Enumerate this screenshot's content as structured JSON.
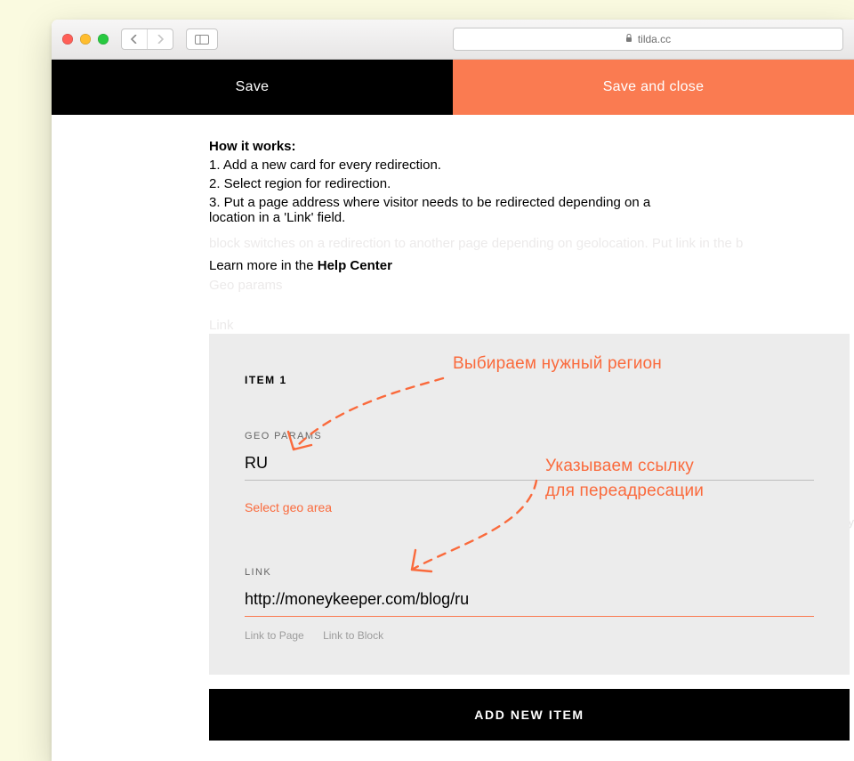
{
  "browser": {
    "domain": "tilda.cc"
  },
  "topbar": {
    "save": "Save",
    "save_close": "Save and close"
  },
  "how": {
    "title": "How it works",
    "l1": "1. Add a new card for every redirection.",
    "l2": "2. Select region for redirection.",
    "l3": "3. Put a page address where visitor needs to be redirected depending on a location in a 'Link' field."
  },
  "learn": {
    "prefix": "Learn more in the ",
    "link": "Help Center"
  },
  "ghost": {
    "g1": "block switches on a redirection to another page depending on geolocation. Put link in the b",
    "g2": "Geo params",
    "g3": "Link"
  },
  "card": {
    "title": "ITEM 1",
    "geo_label": "GEO PARAMS",
    "geo_value": "RU",
    "select_geo": "Select geo area",
    "link_label": "LINK",
    "link_value": "http://moneykeeper.com/blog/ru",
    "link_to_page": "Link to Page",
    "link_to_block": "Link to Block"
  },
  "add_new": "ADD NEW ITEM",
  "anno": {
    "region": "Выбираем нужный регион",
    "link_l1": "Указываем ссылку",
    "link_l2": "для переадресации"
  },
  "gallery_ghost": "Gallery"
}
